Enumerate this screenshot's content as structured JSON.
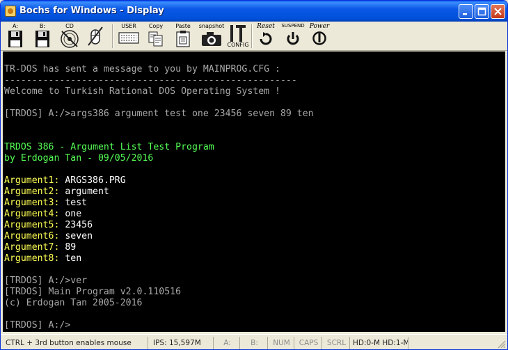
{
  "window": {
    "title": "Bochs for Windows - Display"
  },
  "toolbar": {
    "floppy_a": "A:",
    "floppy_b": "B:",
    "cdrom": "CD",
    "user": "USER",
    "copy": "Copy",
    "paste": "Paste",
    "snapshot": "snapshot",
    "config": "CONFIG",
    "reset": "Reset",
    "suspend": "SUSPEND",
    "power": "Power"
  },
  "console": {
    "lines": [
      "",
      "TR-DOS has sent a message to you by MAINPROG.CFG :",
      "-----------------------------------------------------",
      "Welcome to Turkish Rational DOS Operating System !",
      "",
      "[TRDOS] A:/>args386 argument test one 23456 seven 89 ten",
      "",
      "",
      "TRDOS 386 - Argument List Test Program",
      "by Erdogan Tan - 09/05/2016",
      "",
      "Argument1: ARGS386.PRG",
      "Argument2: argument",
      "Argument3: test",
      "Argument4: one",
      "Argument5: 23456",
      "Argument6: seven",
      "Argument7: 89",
      "Argument8: ten",
      "",
      "[TRDOS] A:/>ver",
      "[TRDOS] Main Program v2.0.110516",
      "(c) Erdogan Tan 2005-2016",
      "",
      "[TRDOS] A:/>"
    ],
    "arg_names": [
      "Argument1:",
      "Argument2:",
      "Argument3:",
      "Argument4:",
      "Argument5:",
      "Argument6:",
      "Argument7:",
      "Argument8:"
    ],
    "arg_values": [
      " ARGS386.PRG",
      " argument",
      " test",
      " one",
      " 23456",
      " seven",
      " 89",
      " ten"
    ],
    "colors": {
      "default": "#a8a8a8",
      "header": "#55ff55",
      "arg_name": "#ffff55",
      "arg_value": "#ffffff",
      "background": "#000000"
    }
  },
  "statusbar": {
    "hint": "CTRL + 3rd button enables mouse",
    "ips": "IPS: 15,597M",
    "a": "A:",
    "b": "B:",
    "num": "NUM",
    "caps": "CAPS",
    "scrl": "SCRL",
    "hd": "HD:0-M HD:1-M"
  }
}
